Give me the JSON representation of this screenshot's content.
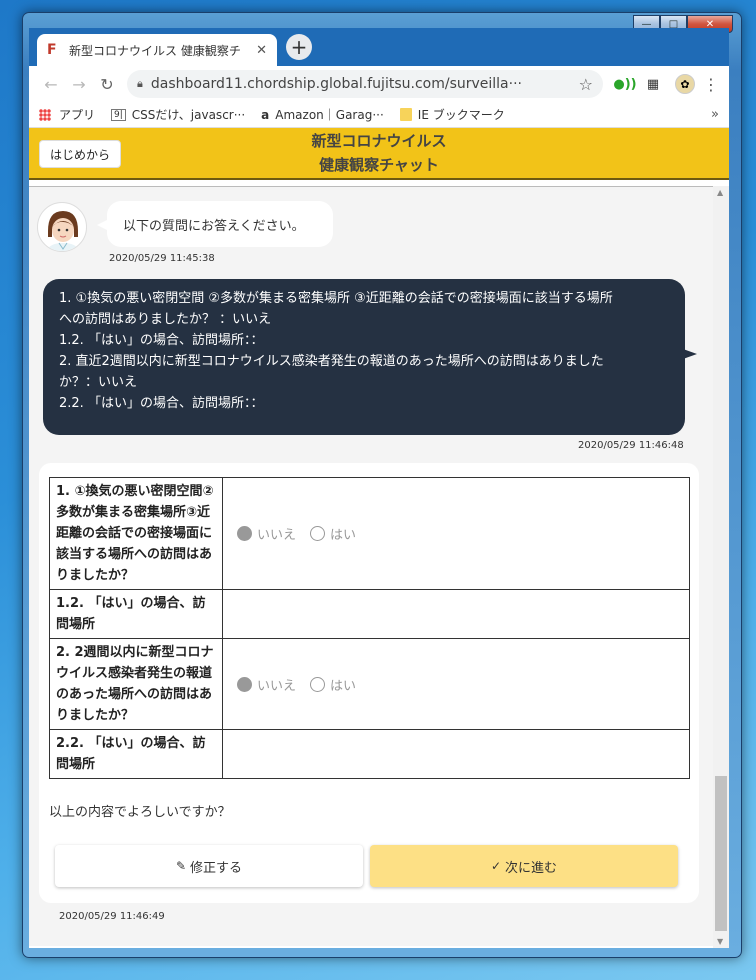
{
  "browser": {
    "tab_favicon": "F",
    "tab_title": "新型コロナウイルス 健康観察チ",
    "tab_close": "✕",
    "new_tab": "+",
    "url": "dashboard11.chordship.global.fujitsu.com/surveilla···",
    "bookmarks": [
      {
        "icon": "apps-icon",
        "label": "アプリ"
      },
      {
        "icon": "page-icon",
        "label": "CSSだけ、javascr···"
      },
      {
        "icon": "amazon-icon",
        "label": "Amazon｜Garag···"
      },
      {
        "icon": "folder-icon",
        "label": "IE ブックマーク"
      }
    ],
    "bookmarks_more": "»"
  },
  "app": {
    "restart_label": "はじめから",
    "title_line1": "新型コロナウイルス",
    "title_line2": "健康観察チャット"
  },
  "chat": {
    "bot_message": "以下の質問にお答えください。",
    "bot_timestamp": "2020/05/29 11:45:38",
    "user_lines": [
      "1. ①換気の悪い密閉空間 ②多数が集まる密集場所 ③近距離の会話での密接場面に該当する場所",
      "への訪問はありましたか？ ：いいえ",
      "1.2. 「はい」の場合、訪問場所：：",
      "2. 直近2週間以内に新型コロナウイルス感染者発生の報道のあった場所への訪問はありました",
      "か？：いいえ",
      "2.2. 「はい」の場合、訪問場所：："
    ],
    "user_timestamp": "2020/05/29 11:46:48",
    "confirm_timestamp": "2020/05/29 11:46:49"
  },
  "confirm": {
    "rows": [
      {
        "question": "1. ①換気の悪い密閉空間②多数が集まる密集場所③近距離の会話での密接場面に該当する場所への訪問はありましたか？",
        "opt_no": "いいえ",
        "opt_yes": "はい"
      },
      {
        "question": "1.2. 「はい」の場合、訪問場所"
      },
      {
        "question": "2. 2週間以内に新型コロナウイルス感染者発生の報道のあった場所への訪問はありましたか？",
        "opt_no": "いいえ",
        "opt_yes": "はい"
      },
      {
        "question": "2.2. 「はい」の場合、訪問場所"
      }
    ],
    "prompt": "以上の内容でよろしいですか？",
    "edit_label": "修正する",
    "next_label": "次に進む"
  }
}
